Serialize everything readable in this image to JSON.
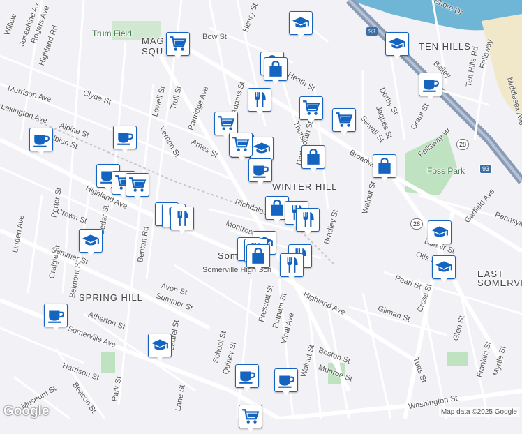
{
  "map": {
    "neighborhoods": [
      "TEN HILLS",
      "WINTER HILL",
      "SPRING HILL",
      "EAST SOMERVILLE"
    ],
    "partial_labels": [
      "MAG",
      "SQU",
      "Som",
      "Somerville High Sch"
    ],
    "parks": [
      "Trum Field",
      "Foss Park"
    ],
    "streets": [
      "Willow",
      "Josephine Av",
      "Rogers Ave",
      "Highland Rd",
      "Bow St",
      "Henry St",
      "Morrison Ave",
      "Clyde St",
      "Lexington Ave",
      "Alpine St",
      "Albion St",
      "Lowell St",
      "Trull St",
      "Partridge Ave",
      "Vernon St",
      "Adams St",
      "Ames St",
      "Medford St",
      "Thurston St",
      "Dartmouth St",
      "Heath St",
      "Derby St",
      "Jaques St",
      "Sewall St",
      "Grant St",
      "Shore Dr",
      "Bailey",
      "Ten Hills Rd",
      "Fellsway",
      "Middlesex Ave",
      "Fellsway W",
      "Broadway",
      "Walnut St",
      "Garfield Ave",
      "Pennsylv",
      "Bonair St",
      "Otis St",
      "Pearl St",
      "Cross St",
      "Gilman St",
      "Glen St",
      "Franklin St",
      "Myrtle St",
      "Tufts St",
      "Washington St",
      "Highland Ave",
      "Porter St",
      "Crown St",
      "Cedar St",
      "Linden Ave",
      "Summer St",
      "Craigie St",
      "Belmont St",
      "Benton Rd",
      "Richdale Ave",
      "Montrose St",
      "Bradley St",
      "Prescott St",
      "Putnam St",
      "Vinal Ave",
      "Avon St",
      "Atherton St",
      "Laurel St",
      "School St",
      "Quincy St",
      "Boston St",
      "Munroe St",
      "Walnut St",
      "Somerville Ave",
      "Harrison St",
      "Museum St",
      "Beacon St",
      "Park St",
      "Lane St",
      "Bedford St",
      "Hall St"
    ],
    "highways": [
      "93",
      "28"
    ],
    "poi_icons": [
      "school-icon",
      "shopping-cart-icon",
      "shopping-bag-icon",
      "fork-knife-icon",
      "coffee-cup-icon"
    ],
    "accent_color": "#1565c0",
    "road_color": "#ffffff",
    "highway_color": "#8a9bb5",
    "water_color": "#6fb5d6",
    "park_color": "#bfe3c0"
  },
  "footer": {
    "logo": "Google",
    "attribution": "Map data ©2025 Google"
  }
}
